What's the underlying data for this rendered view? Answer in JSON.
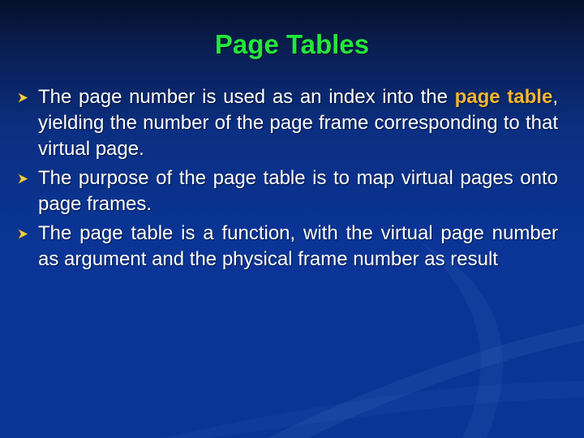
{
  "slide": {
    "title": "Page Tables",
    "title_color": "#22e83c",
    "highlight_color": "#f5b731",
    "bullet_icon": "arrowhead-bullet-icon",
    "bullets": [
      {
        "before": "The page number is used as an index into the ",
        "highlight": "page table",
        "after": ", yielding the number of the page frame corresponding to that virtual page."
      },
      {
        "text": "The purpose of the page table is to map virtual pages onto page frames."
      },
      {
        "text": "The page table is a function, with the virtual page number as argument and the physical frame number as result"
      }
    ]
  }
}
